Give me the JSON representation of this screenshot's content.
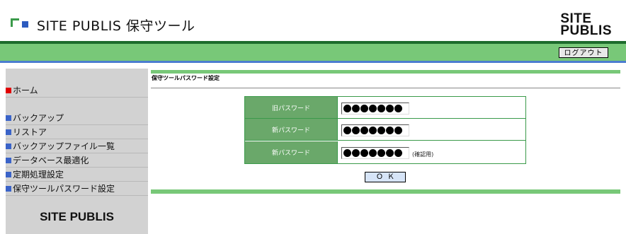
{
  "header": {
    "app_title": "SITE PUBLIS 保守ツール",
    "brand_line1": "SITE",
    "brand_line2": "PUBLIS",
    "logout_label": "ログアウト"
  },
  "sidebar": {
    "items": [
      {
        "label": "ホーム"
      },
      {
        "label": "バックアップ"
      },
      {
        "label": "リストア"
      },
      {
        "label": "バックアップファイル一覧"
      },
      {
        "label": "データベース最適化"
      },
      {
        "label": "定期処理設定"
      },
      {
        "label": "保守ツールパスワード設定"
      }
    ],
    "brand": "SITE PUBLIS"
  },
  "main": {
    "section_title": "保守ツールパスワード設定",
    "rows": [
      {
        "label": "旧パスワード",
        "value_mask": "●●●●●●●",
        "note": ""
      },
      {
        "label": "新パスワード",
        "value_mask": "●●●●●●●",
        "note": ""
      },
      {
        "label": "新パスワード",
        "value_mask": "●●●●●●●",
        "note": "(確認用)"
      }
    ],
    "ok_label": "ＯＫ"
  },
  "colors": {
    "green_bar": "#78c878",
    "dark_green": "#1d6b2c",
    "blue_bar": "#4c7dd0",
    "label_bg": "#6aa86a",
    "home_marker": "#e00000",
    "nav_marker": "#3a63c8"
  }
}
